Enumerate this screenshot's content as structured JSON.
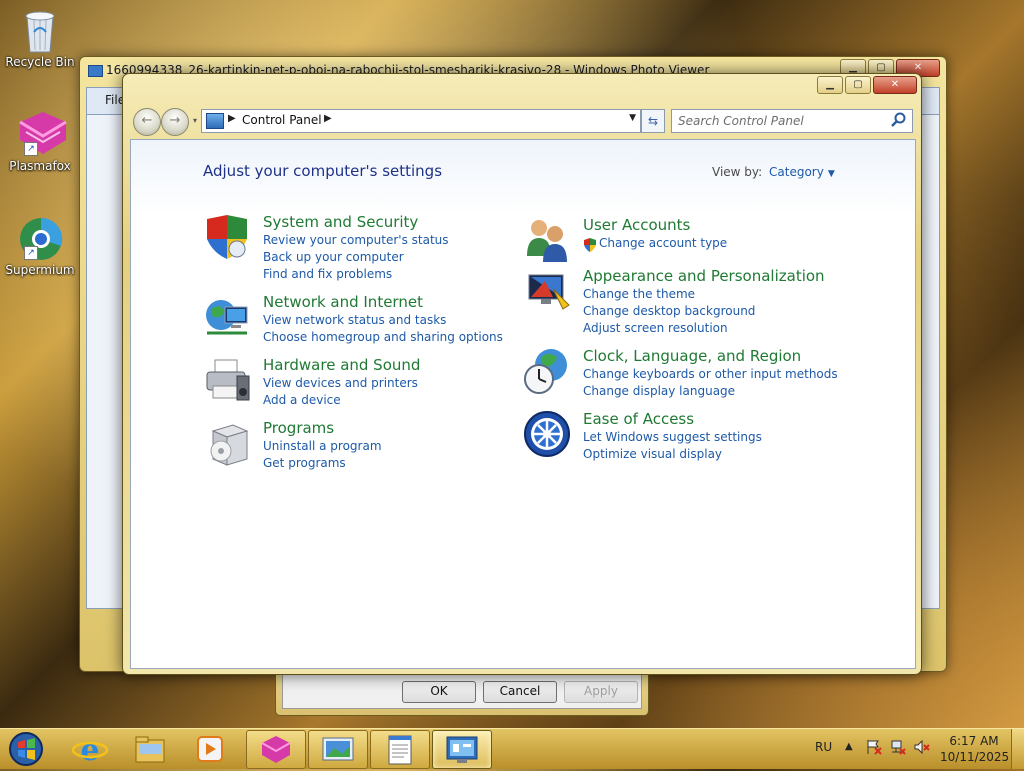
{
  "desktop": {
    "icons": [
      {
        "label": "Recycle Bin",
        "icon": "recycle-bin-icon"
      },
      {
        "label": "Plasmafox",
        "icon": "plasmafox-icon"
      },
      {
        "label": "Supermium",
        "icon": "supermium-icon"
      }
    ]
  },
  "photo_viewer": {
    "title": "1660994338_26-kartinkin-net-p-oboi-na-rabochii-stol-smeshariki-krasivo-28 - Windows Photo Viewer",
    "menu_file": "File"
  },
  "dialog": {
    "ok": "OK",
    "cancel": "Cancel",
    "apply": "Apply"
  },
  "control_panel": {
    "breadcrumb": "Control Panel",
    "search_placeholder": "Search Control Panel",
    "heading": "Adjust your computer's settings",
    "view_by_label": "View by:",
    "view_by_value": "Category",
    "categories": [
      {
        "title": "System and Security",
        "icon": "shield-icon",
        "links": [
          "Review your computer's status",
          "Back up your computer",
          "Find and fix problems"
        ]
      },
      {
        "title": "Network and Internet",
        "icon": "network-globe-icon",
        "links": [
          "View network status and tasks",
          "Choose homegroup and sharing options"
        ]
      },
      {
        "title": "Hardware and Sound",
        "icon": "printer-icon",
        "links": [
          "View devices and printers",
          "Add a device"
        ]
      },
      {
        "title": "Programs",
        "icon": "programs-box-icon",
        "links": [
          "Uninstall a program",
          "Get programs"
        ]
      },
      {
        "title": "User Accounts",
        "icon": "users-icon",
        "links": [
          "Change account type"
        ]
      },
      {
        "title": "Appearance and Personalization",
        "icon": "monitor-palette-icon",
        "links": [
          "Change the theme",
          "Change desktop background",
          "Adjust screen resolution"
        ]
      },
      {
        "title": "Clock, Language, and Region",
        "icon": "globe-clock-icon",
        "links": [
          "Change keyboards or other input methods",
          "Change display language"
        ]
      },
      {
        "title": "Ease of Access",
        "icon": "ease-of-access-icon",
        "links": [
          "Let Windows suggest settings",
          "Optimize visual display"
        ]
      }
    ]
  },
  "taskbar": {
    "language": "RU",
    "time": "6:17 AM",
    "date": "10/11/2025",
    "pinned": [
      "start-orb-icon",
      "internet-explorer-icon",
      "file-explorer-icon",
      "media-player-icon",
      "plasmafox-icon",
      "photo-viewer-icon",
      "notepad-icon",
      "control-panel-icon"
    ]
  },
  "colors": {
    "link": "#1e5aa8",
    "category_title": "#1f7a33",
    "heading": "#1e3287",
    "taskbar": "#c9a33a"
  }
}
